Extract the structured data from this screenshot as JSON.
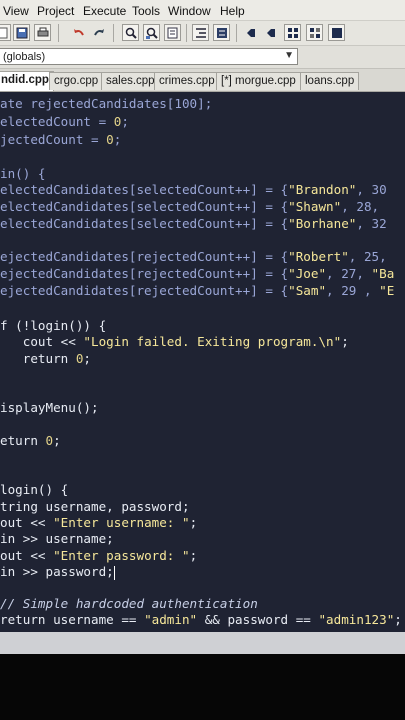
{
  "menu": {
    "items": [
      "View",
      "Project",
      "Execute",
      "Tools",
      "Window",
      "Help"
    ]
  },
  "scope": {
    "value": "(globals)"
  },
  "tabs": [
    "ndid.cpp",
    "crgo.cpp",
    "sales.cpp",
    "crimes.cpp",
    "[*] morgue.cpp",
    "loans.cpp"
  ],
  "active_tab": 0,
  "code": {
    "l1": "ate rejectedCandidates[100];",
    "l2a": "electedCount = ",
    "l2b": "0",
    "l2c": ";",
    "l3a": "jectedCount = ",
    "l3b": "0",
    "l3c": ";",
    "l4": "in() {",
    "l5a": "electedCandidates[selectedCount++] = {",
    "l5b": "\"Brandon\"",
    "l5c": ", 30",
    "l6a": "electedCandidates[selectedCount++] = {",
    "l6b": "\"Shawn\"",
    "l6c": ", 28, ",
    "l7a": "electedCandidates[selectedCount++] = {",
    "l7b": "\"Borhane\"",
    "l7c": ", 32",
    "l8a": "ejectedCandidates[rejectedCount++] = {",
    "l8b": "\"Robert\"",
    "l8c": ", 25,",
    "l9a": "ejectedCandidates[rejectedCount++] = {",
    "l9b": "\"Joe\"",
    "l9c": ", 27, ",
    "l9d": "\"Ba",
    "l10a": "ejectedCandidates[rejectedCount++] = {",
    "l10b": "\"Sam\"",
    "l10c": ", 29 , ",
    "l10d": "\"E",
    "l11": "f (!login()) {",
    "l12a": "   cout << ",
    "l12b": "\"Login failed. Exiting program.\\n\"",
    "l12c": ";",
    "l13a": "   return ",
    "l13b": "0",
    "l13c": ";",
    "l14": "isplayMenu();",
    "l15a": "eturn ",
    "l15b": "0",
    "l15c": ";",
    "l16": "login() {",
    "l17": "tring username, password;",
    "l18a": "out << ",
    "l18b": "\"Enter username: \"",
    "l18c": ";",
    "l19": "in >> username;",
    "l20a": "out << ",
    "l20b": "\"Enter password: \"",
    "l20c": ";",
    "l21": "in >> password;",
    "l22": "// Simple hardcoded authentication",
    "l23a": "return username == ",
    "l23b": "\"admin\"",
    "l23c": " && password == ",
    "l23d": "\"admin123\"",
    "l23e": ";"
  },
  "colors": {
    "editor_bg": "#1f2333",
    "string": "#f6e79a",
    "text": "#e8ecf4"
  },
  "icons": [
    "new-file-icon",
    "save-icon",
    "print-icon",
    "undo-icon",
    "redo-icon",
    "find-icon",
    "replace-icon",
    "indent-icon",
    "unindent-icon",
    "bookmark-icon",
    "goto-icon"
  ]
}
